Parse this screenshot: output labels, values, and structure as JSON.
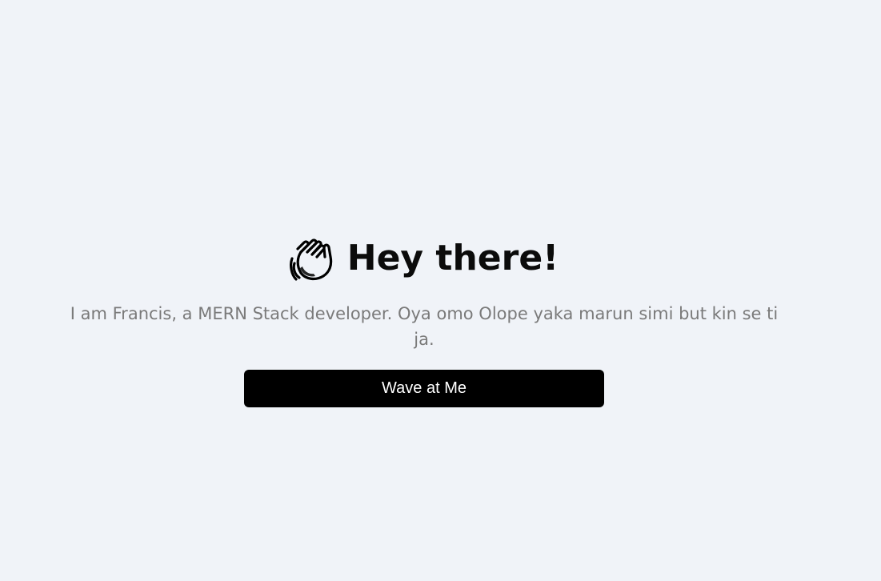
{
  "hero": {
    "icon": "waving-hand-icon",
    "title": "Hey there!",
    "bio": "I am Francis, a MERN Stack developer. Oya omo Olope yaka marun simi but kin se ti ja.",
    "wave_button_label": "Wave at Me"
  },
  "colors": {
    "background": "#f0f3f8",
    "title": "#0b0b0b",
    "bio": "#7a7a7a",
    "button_bg": "#000000",
    "button_text": "#ffffff"
  }
}
